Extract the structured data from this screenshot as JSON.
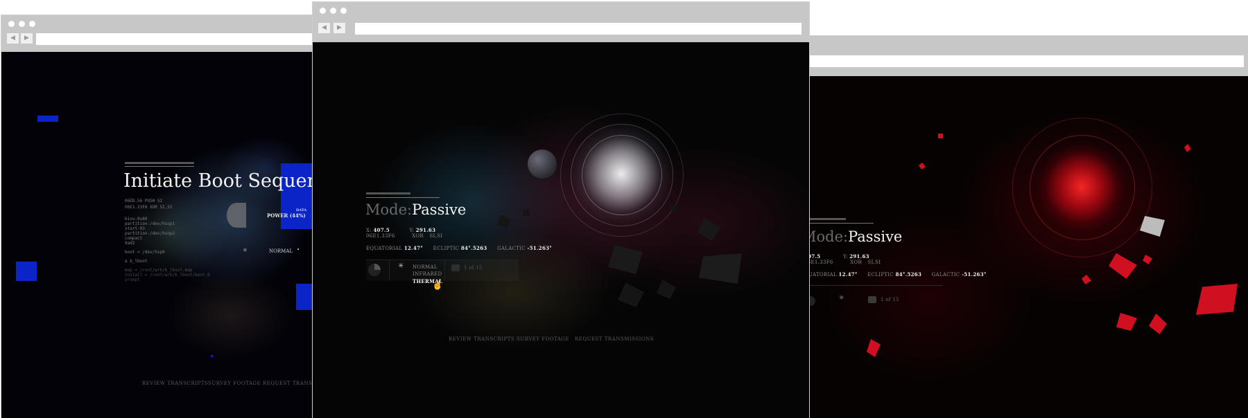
{
  "left_window": {
    "title": "Initiate Boot Sequen",
    "code_lines_top": [
      "06ED.56 PUSH SI",
      "06E1.33F6 XOR SI,SI"
    ],
    "code_block": [
      "bios-0x80",
      "partition-/dev/hsop1",
      "start-03",
      "partition-/dev/hsop2",
      "compact",
      "9ad2",
      "",
      "boot = /dev/hsp0",
      "",
      "a b_lboot",
      "",
      "map = /root/wrk/b_lboot.map",
      "install = /root/wrk/b_lboot/boot.b",
      "prompt"
    ],
    "power_label": "POWER (44%)",
    "data_label": "DATA",
    "normal_label": "NORMAL",
    "footer_links": [
      "REVIEW TRANSCRIPTS",
      "SURVEY FOOTAGE",
      "REQUEST TRANSMISS"
    ]
  },
  "center_window": {
    "mode_prefix": "Mode:",
    "mode_value": "Passive",
    "coords": {
      "x_label": "X:",
      "x_value": "407.5",
      "y_label": "Y:",
      "y_value": "291.63"
    },
    "code_line": [
      "06E1.33F6",
      "XOR",
      "SI,SI"
    ],
    "measures": [
      {
        "label": "EQUATORIAL",
        "value": "12.47°"
      },
      {
        "label": "ECLIPTIC",
        "value": "84°.5263"
      },
      {
        "label": "GALACTIC",
        "value": "-51.263°"
      }
    ],
    "filters": [
      "NORMAL",
      "INFRARED",
      "THERMAL"
    ],
    "pager": "1 of 15",
    "footer_links": [
      "REVIEW TRANSCRIPTS",
      "SURVEY FOOTAGE",
      "REQUEST TRANSMISSIONS"
    ]
  },
  "right_window": {
    "mode_prefix": "Mode:",
    "mode_value": "Passive",
    "coords": {
      "x_value": "407.5",
      "y_label": "Y:",
      "y_value": "291.63"
    },
    "code_line": [
      "06E1.33F6",
      "XOR",
      "SI,SI"
    ],
    "measures": [
      {
        "label": "QUATORIAL",
        "value": "12.47°"
      },
      {
        "label": "ECLIPTIC",
        "value": "84°.5263"
      },
      {
        "label": "GALACTIC",
        "value": "-51.263°"
      }
    ],
    "pager": "1 of 15"
  },
  "colors": {
    "boot_blue": "#0a24c8",
    "thermal_red": "#d01020",
    "chrome_gray": "#c7c7c7"
  },
  "icons": [
    "crosshair-icon",
    "pie-chart-icon",
    "pointer-hand-icon",
    "camera-icon"
  ]
}
